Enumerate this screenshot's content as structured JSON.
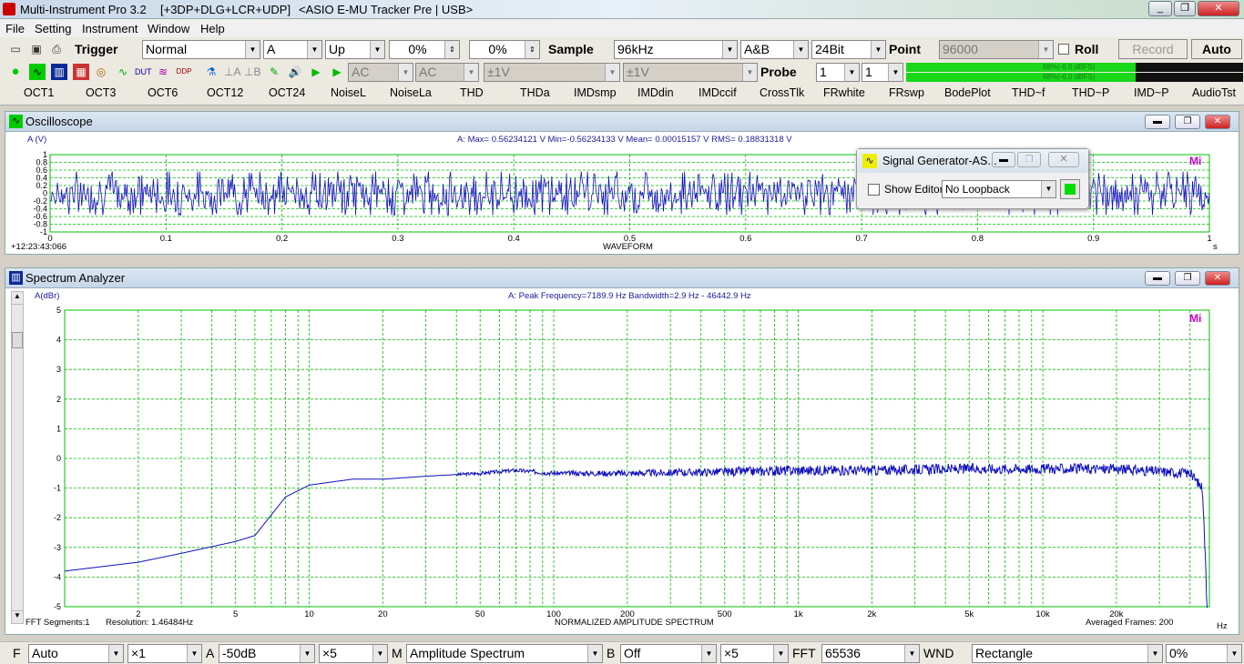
{
  "window": {
    "title": "Multi-Instrument Pro 3.2",
    "plugins": "[+3DP+DLG+LCR+UDP]",
    "device": "<ASIO E-MU Tracker Pre | USB>"
  },
  "menu": [
    "File",
    "Setting",
    "Instrument",
    "Window",
    "Help"
  ],
  "toolbar1": {
    "trigger_label": "Trigger",
    "trigger_mode": "Normal",
    "trigger_channel": "A",
    "trigger_edge": "Up",
    "trigger_level": "0%",
    "trigger_delay": "0%",
    "sample_label": "Sample",
    "sample_rate": "96kHz",
    "channels": "A&B",
    "bits": "24Bit",
    "point_label": "Point",
    "points": "96000",
    "roll_label": "Roll",
    "record_label": "Record",
    "auto_label": "Auto"
  },
  "toolbar2": {
    "coupling_a": "AC",
    "coupling_b": "AC",
    "range_a": "±1V",
    "range_b": "±1V",
    "probe_label": "Probe",
    "probe_a": "1",
    "probe_b": "1",
    "level_a": "68%(-6.0 dBFS)",
    "level_b": "68%(-6.0 dBFS)"
  },
  "quick": [
    "OCT1",
    "OCT3",
    "OCT6",
    "OCT12",
    "OCT24",
    "NoiseL",
    "NoiseLa",
    "THD",
    "THDa",
    "IMDsmp",
    "IMDdin",
    "IMDccif",
    "CrossTlk",
    "FRwhite",
    "FRswp",
    "BodePlot",
    "THD~f",
    "THD~P",
    "IMD~P",
    "AudioTst"
  ],
  "osc": {
    "title": "Oscilloscope",
    "ylabel": "A (V)",
    "stats": "A: Max= 0.56234121 V  Min=-0.56234133 V  Mean= 0.00015157 V  RMS= 0.18831318 V",
    "yticks": [
      "1",
      "0.8",
      "0.6",
      "0.4",
      "0.2",
      "0",
      "-0.2",
      "-0.4",
      "-0.6",
      "-0.8",
      "-1"
    ],
    "xticks": [
      "0",
      "0.1",
      "0.2",
      "0.3",
      "0.4",
      "0.5",
      "0.6",
      "0.7",
      "0.8",
      "0.9",
      "1"
    ],
    "xunit": "s",
    "timestamp": "+12:23:43:066",
    "xlabel": "WAVEFORM",
    "logo": "Mi"
  },
  "siggen": {
    "title": "Signal Generator-AS...",
    "show_editor": "Show Editor",
    "loopback": "No Loopback"
  },
  "spec": {
    "title": "Spectrum Analyzer",
    "ylabel": "A(dBr)",
    "stats": "A: Peak Frequency=7189.9 Hz  Bandwidth=2.9 Hz - 46442.9 Hz",
    "yticks": [
      "5",
      "4",
      "3",
      "2",
      "1",
      "0",
      "-1",
      "-2",
      "-3",
      "-4",
      "-5"
    ],
    "xticks": [
      "2",
      "5",
      "10",
      "20",
      "50",
      "100",
      "200",
      "500",
      "1k",
      "2k",
      "5k",
      "10k",
      "20k"
    ],
    "xunit": "Hz",
    "fft_segments": "FFT Segments:1",
    "resolution": "Resolution: 1.46484Hz",
    "xlabel": "NORMALIZED AMPLITUDE SPECTRUM",
    "averaged": "Averaged Frames: 200",
    "logo": "Mi"
  },
  "status": {
    "f_label": "F",
    "f_val": "Auto",
    "f_mult": "×1",
    "a_label": "A",
    "a_val": "-50dB",
    "a_mult": "×5",
    "m_label": "M",
    "m_val": "Amplitude Spectrum",
    "b_label": "B",
    "b_val": "Off",
    "b_mult": "×5",
    "fft_label": "FFT",
    "fft_val": "65536",
    "wnd_label": "WND",
    "wnd_val": "Rectangle",
    "overlap": "0%"
  },
  "colors": {
    "trace": "#1010c0",
    "grid": "#00c000",
    "accent": "#00e000"
  },
  "chart_data": [
    {
      "type": "line",
      "title": "Oscilloscope",
      "xlabel": "WAVEFORM",
      "ylabel": "A (V)",
      "xlim": [
        0,
        1
      ],
      "ylim": [
        -1,
        1
      ],
      "grid": true,
      "series": [
        {
          "name": "A",
          "description": "noise waveform",
          "max": 0.56234121,
          "min": -0.56234133,
          "mean": 0.00015157,
          "rms": 0.18831318
        }
      ]
    },
    {
      "type": "line",
      "title": "Spectrum Analyzer",
      "xlabel": "NORMALIZED AMPLITUDE SPECTRUM",
      "ylabel": "A(dBr)",
      "xscale": "log",
      "xlim": [
        1,
        48000
      ],
      "ylim": [
        -5,
        5
      ],
      "grid": true,
      "series": [
        {
          "name": "A",
          "x": [
            1,
            2,
            3,
            5,
            6,
            8,
            10,
            15,
            20,
            30,
            50,
            70,
            100,
            200,
            500,
            1000,
            2000,
            5000,
            10000,
            20000,
            40000,
            45000,
            47000
          ],
          "y": [
            -3.8,
            -3.5,
            -3.2,
            -2.8,
            -2.6,
            -1.3,
            -0.9,
            -0.7,
            -0.7,
            -0.6,
            -0.5,
            -0.4,
            -0.5,
            -0.5,
            -0.45,
            -0.4,
            -0.4,
            -0.35,
            -0.35,
            -0.35,
            -0.5,
            -1.0,
            -5.0
          ]
        }
      ]
    }
  ]
}
